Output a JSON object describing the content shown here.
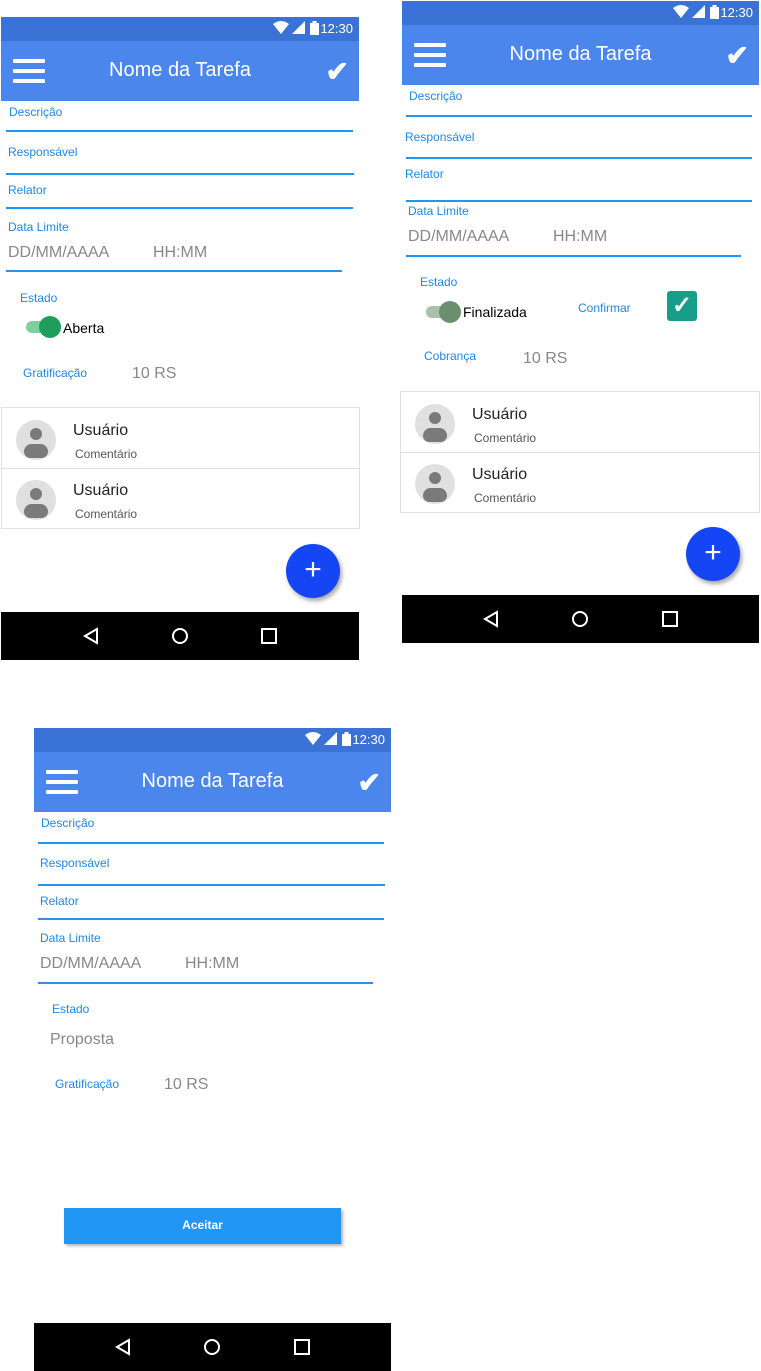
{
  "status": {
    "time": "12:30"
  },
  "screens": [
    {
      "title": "Nome da Tarefa",
      "labels": {
        "descricao": "Descrição",
        "responsavel": "Responsável",
        "relator": "Relator",
        "data_limite": "Data Limite",
        "estado": "Estado",
        "gratificacao": "Gratificação"
      },
      "date_placeholder": "DD/MM/AAAA",
      "time_placeholder": "HH:MM",
      "estado_value": "Aberta",
      "gratificacao_value": "10 RS",
      "comments": [
        {
          "user": "Usuário",
          "comment": "Comentário"
        },
        {
          "user": "Usuário",
          "comment": "Comentário"
        }
      ]
    },
    {
      "title": "Nome da Tarefa",
      "labels": {
        "descricao": "Descrição",
        "responsavel": "Responsável",
        "relator": "Relator",
        "data_limite": "Data Limite",
        "estado": "Estado",
        "confirmar": "Confirmar",
        "cobranca": "Cobrança"
      },
      "date_placeholder": "DD/MM/AAAA",
      "time_placeholder": "HH:MM",
      "estado_value": "Finalizada",
      "confirmar_checked": true,
      "cobranca_value": "10 RS",
      "comments": [
        {
          "user": "Usuário",
          "comment": "Comentário"
        },
        {
          "user": "Usuário",
          "comment": "Comentário"
        }
      ]
    },
    {
      "title": "Nome da Tarefa",
      "labels": {
        "descricao": "Descrição",
        "responsavel": "Responsável",
        "relator": "Relator",
        "data_limite": "Data Limite",
        "estado": "Estado",
        "gratificacao": "Gratificação"
      },
      "date_placeholder": "DD/MM/AAAA",
      "time_placeholder": "HH:MM",
      "estado_value": "Proposta",
      "gratificacao_value": "10 RS",
      "accept_label": "Aceitar"
    }
  ],
  "colors": {
    "statusbar": "#3b72d6",
    "appbar": "#4a86eb",
    "field_line": "#2196f3",
    "fab": "#1546f5",
    "toggle_on": "#1e9e5a",
    "toggle_off": "#6b8f6e",
    "checkbox": "#189e88"
  },
  "icons": {
    "menu": "menu-icon",
    "check": "check-icon",
    "add": "add-icon",
    "back": "back-icon",
    "home": "home-icon",
    "recent": "recent-apps-icon",
    "wifi": "wifi-icon",
    "signal": "signal-icon",
    "battery": "battery-icon",
    "avatar": "avatar-icon"
  }
}
